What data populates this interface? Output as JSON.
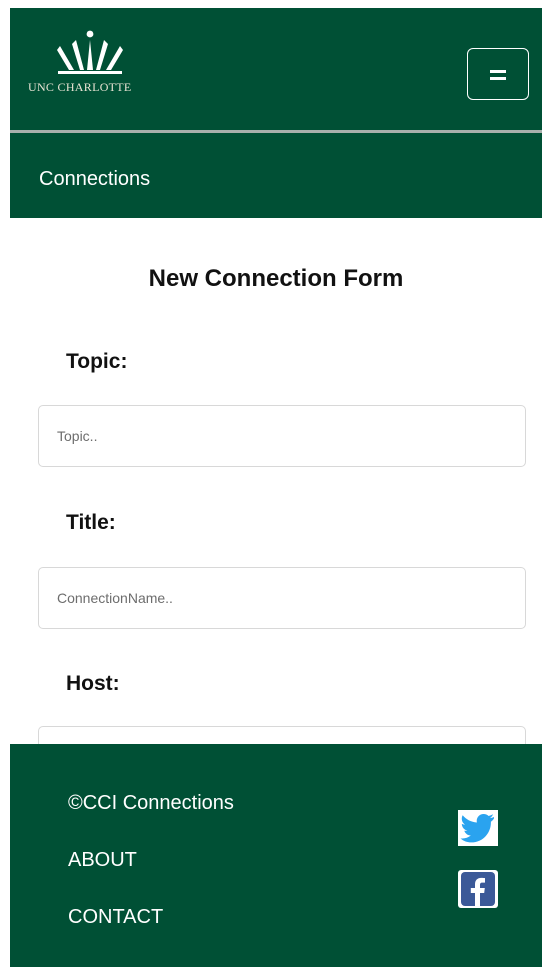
{
  "header": {
    "logo_text": "UNC CHARLOTTE",
    "menu_icon": "hamburger-menu-icon"
  },
  "subnav": {
    "label": "Connections"
  },
  "form": {
    "title": "New Connection Form",
    "fields": [
      {
        "label": "Topic:",
        "placeholder": "Topic.."
      },
      {
        "label": "Title:",
        "placeholder": "ConnectionName.."
      },
      {
        "label": "Host:",
        "placeholder": ""
      }
    ]
  },
  "footer": {
    "copyright": "©CCI Connections",
    "about": "ABOUT",
    "contact": "CONTACT",
    "social_icons": [
      "twitter-icon",
      "facebook-icon"
    ]
  },
  "colors": {
    "brand_green": "#005035",
    "twitter_blue": "#2aa3ef",
    "facebook_blue": "#3b5998"
  }
}
